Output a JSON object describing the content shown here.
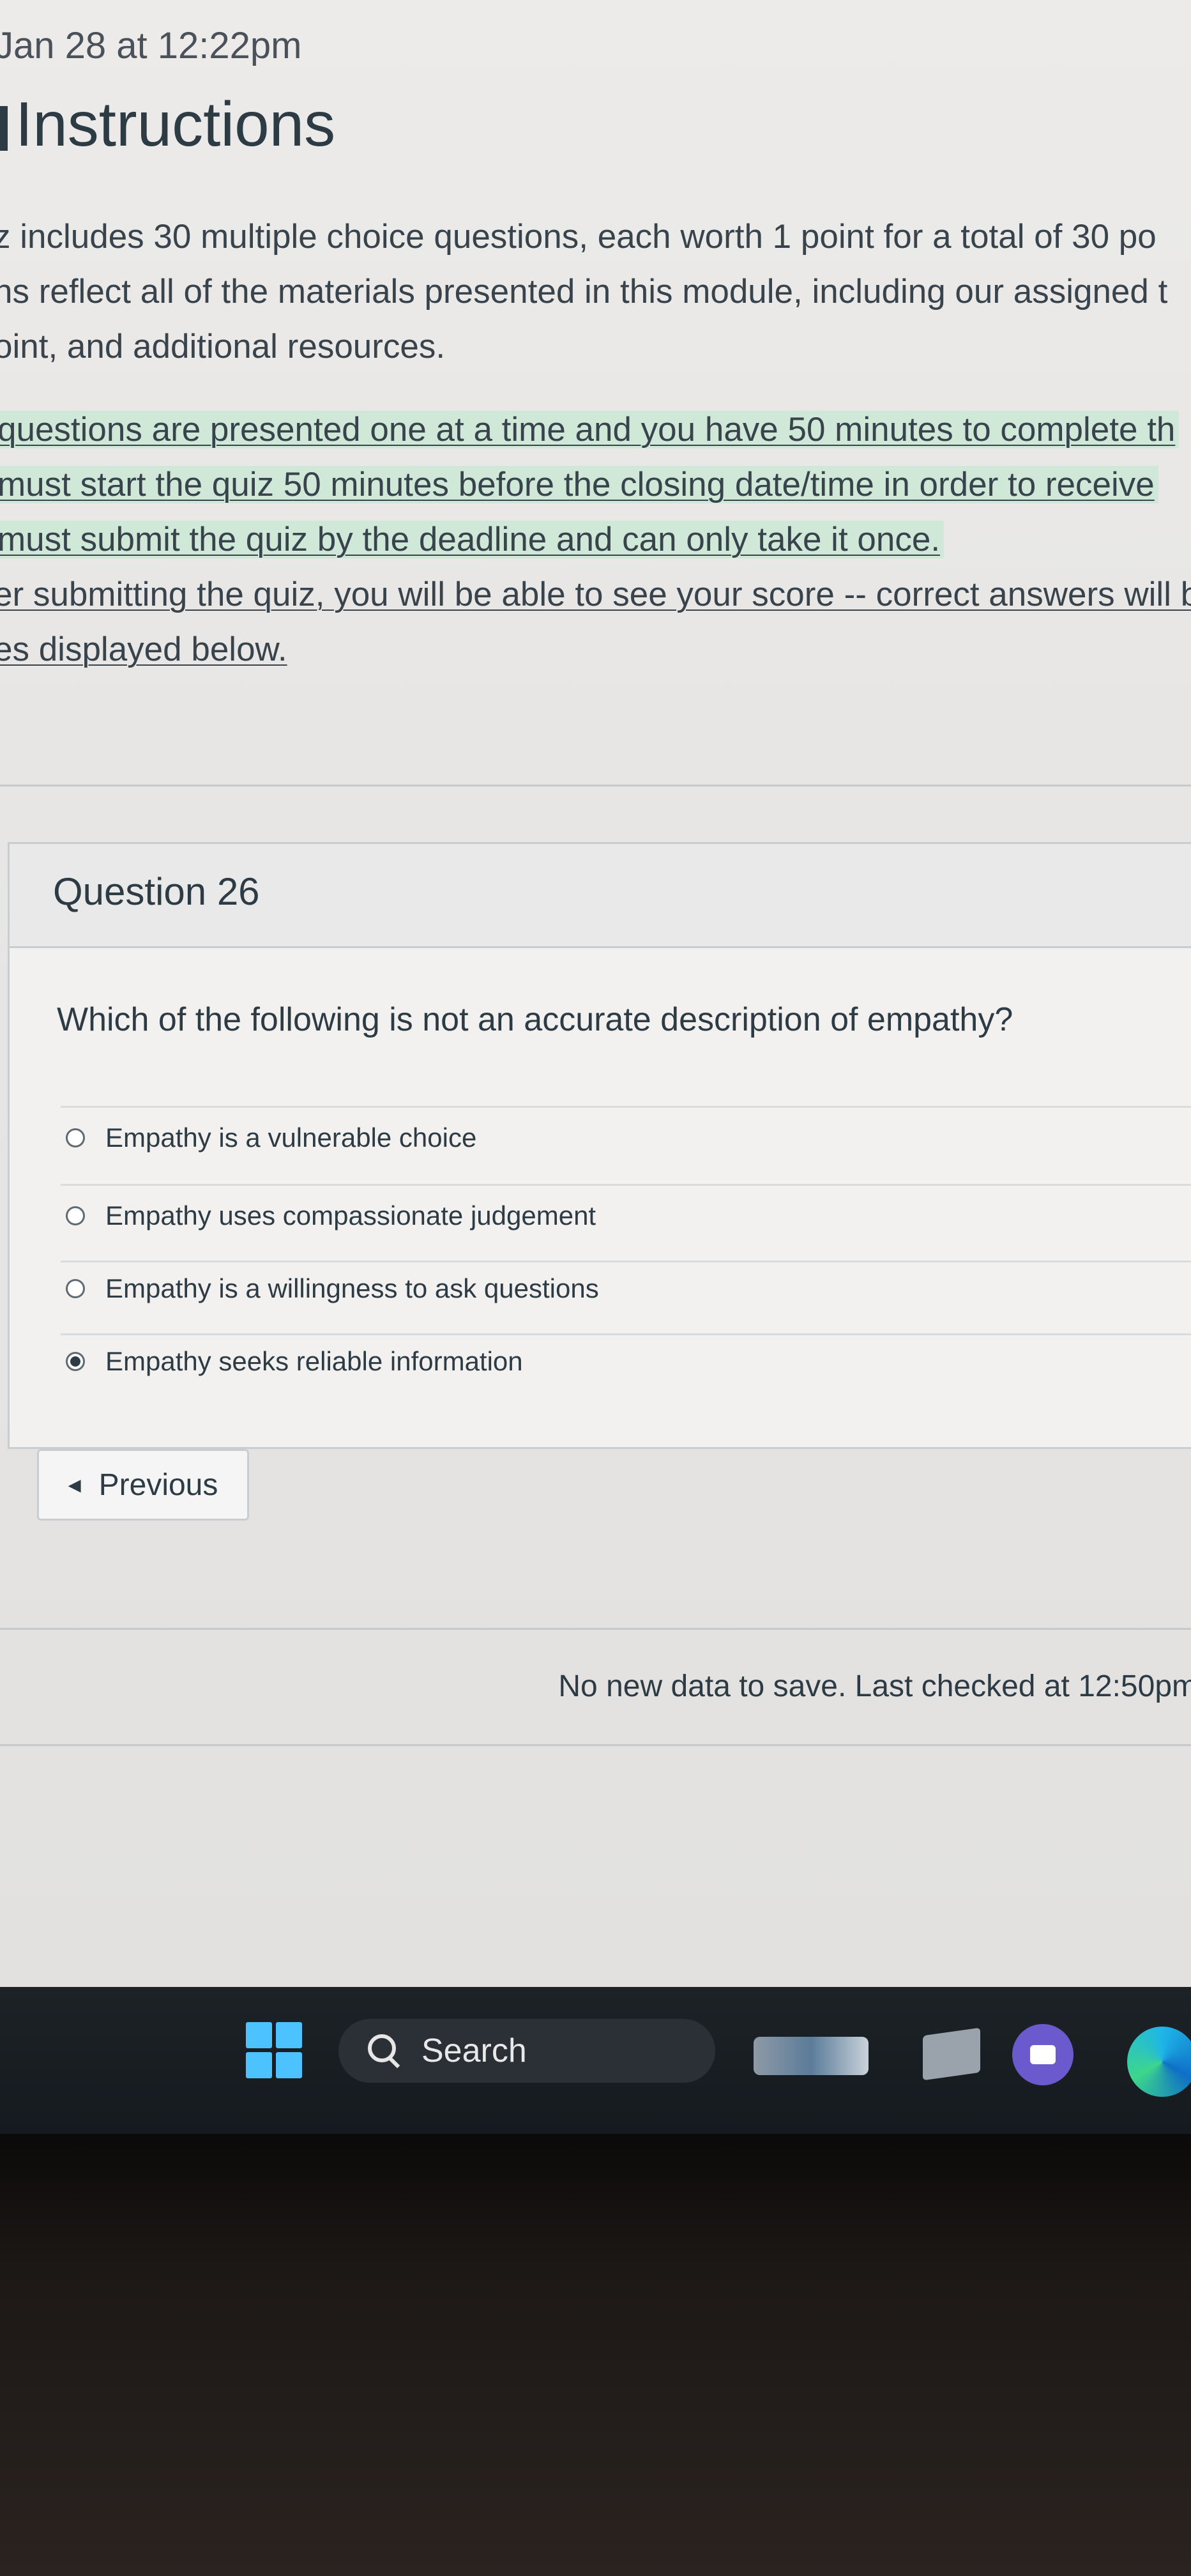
{
  "header": {
    "due_text": "Jan 28 at 12:22pm",
    "section_title": "Instructions"
  },
  "instructions": {
    "lines": [
      "z includes 30 multiple choice questions, each worth 1 point for a total of 30 po",
      "ns reflect all of the materials presented in this module, including our assigned t",
      "oint, and additional resources."
    ],
    "highlighted_lines": [
      "questions are presented one at a time and you have 50 minutes to complete th",
      "must start the quiz 50 minutes before the closing date/time in order to receive",
      "must submit the quiz by the deadline and can only take it once.",
      "er submitting the quiz, you will be able to see your score -- correct answers will b",
      "es displayed below."
    ]
  },
  "question": {
    "title": "Question 26",
    "text": "Which of the following is not an accurate description of empathy?",
    "answers": [
      {
        "label": "Empathy is a vulnerable choice",
        "selected": false
      },
      {
        "label": "Empathy uses compassionate judgement",
        "selected": false
      },
      {
        "label": "Empathy is a willingness to ask questions",
        "selected": false
      },
      {
        "label": "Empathy seeks reliable information",
        "selected": true
      }
    ]
  },
  "navigation": {
    "previous_label": "Previous"
  },
  "status": {
    "save_text": "No new data to save. Last checked at 12:50pm"
  },
  "taskbar": {
    "search_label": "Search",
    "icons": [
      "windows-start-icon",
      "search-icon",
      "widgets-icon",
      "file-explorer-icon",
      "video-meeting-icon",
      "edge-browser-icon"
    ],
    "accent": "#4cc2ff"
  },
  "colors": {
    "text": "#2d3b45",
    "highlight": "#cfe8d8",
    "border": "#c7cdd1"
  }
}
